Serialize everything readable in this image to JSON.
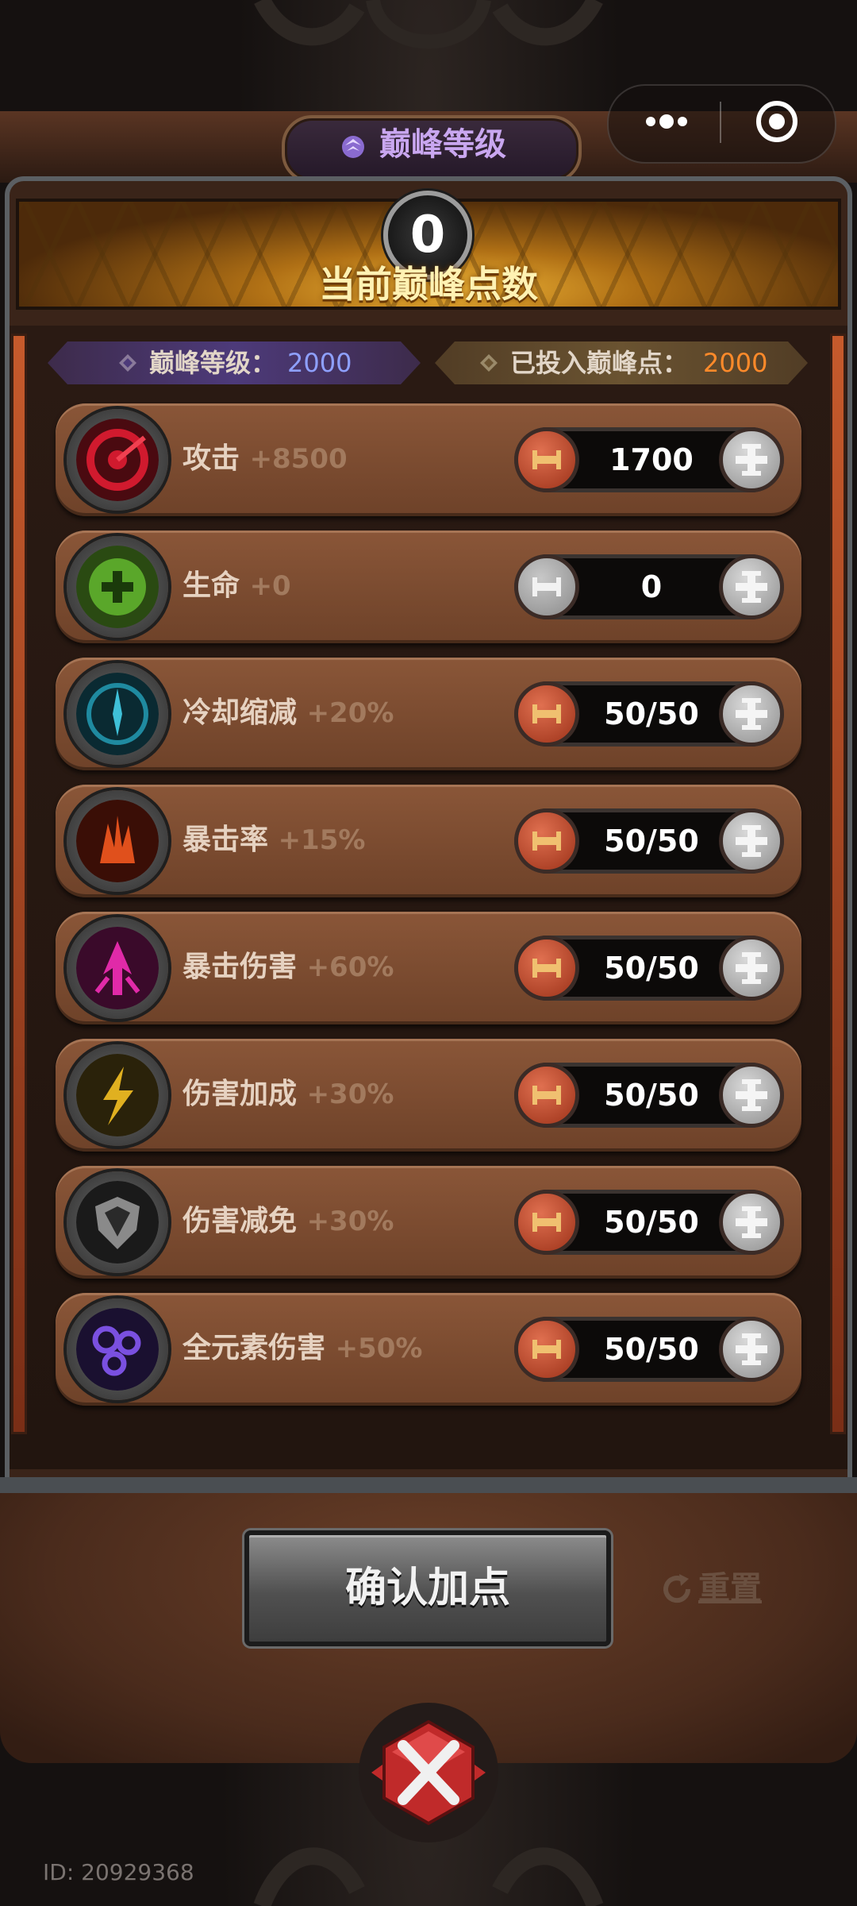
{
  "header": {
    "title": "巅峰等级",
    "more_icon": "more-dots-icon",
    "target_icon": "target-icon"
  },
  "banner": {
    "points_value": "0",
    "points_label": "当前巅峰点数"
  },
  "info": {
    "level_label": "巅峰等级：",
    "level_value": "2000",
    "invested_label": "已投入巅峰点：",
    "invested_value": "2000",
    "level_color": "#8ea0ff",
    "invested_color": "#ff8a2a"
  },
  "stats": [
    {
      "name": "攻击",
      "bonus": "+8500",
      "value": "1700",
      "icon": "attack-target-icon",
      "color": "#c4162a"
    },
    {
      "name": "生命",
      "bonus": "+0",
      "value": "0",
      "icon": "health-icon",
      "color": "#5aa72a"
    },
    {
      "name": "冷却缩减",
      "bonus": "+20%",
      "value": "50/50",
      "icon": "cooldown-clock-icon",
      "color": "#1f8aa0"
    },
    {
      "name": "暴击率",
      "bonus": "+15%",
      "value": "50/50",
      "icon": "crit-rate-flame-icon",
      "color": "#d4441a"
    },
    {
      "name": "暴击伤害",
      "bonus": "+60%",
      "value": "50/50",
      "icon": "crit-damage-arrow-icon",
      "color": "#d0219a"
    },
    {
      "name": "伤害加成",
      "bonus": "+30%",
      "value": "50/50",
      "icon": "damage-bonus-lightning-icon",
      "color": "#d2a21c"
    },
    {
      "name": "伤害减免",
      "bonus": "+30%",
      "value": "50/50",
      "icon": "damage-reduction-shield-icon",
      "color": "#9a9a9a"
    },
    {
      "name": "全元素伤害",
      "bonus": "+50%",
      "value": "50/50",
      "icon": "elemental-damage-orbs-icon",
      "color": "#6a3fd0"
    }
  ],
  "actions": {
    "confirm_label": "确认加点",
    "reset_label": "重置"
  },
  "footer": {
    "user_id": "ID: 20929368"
  }
}
